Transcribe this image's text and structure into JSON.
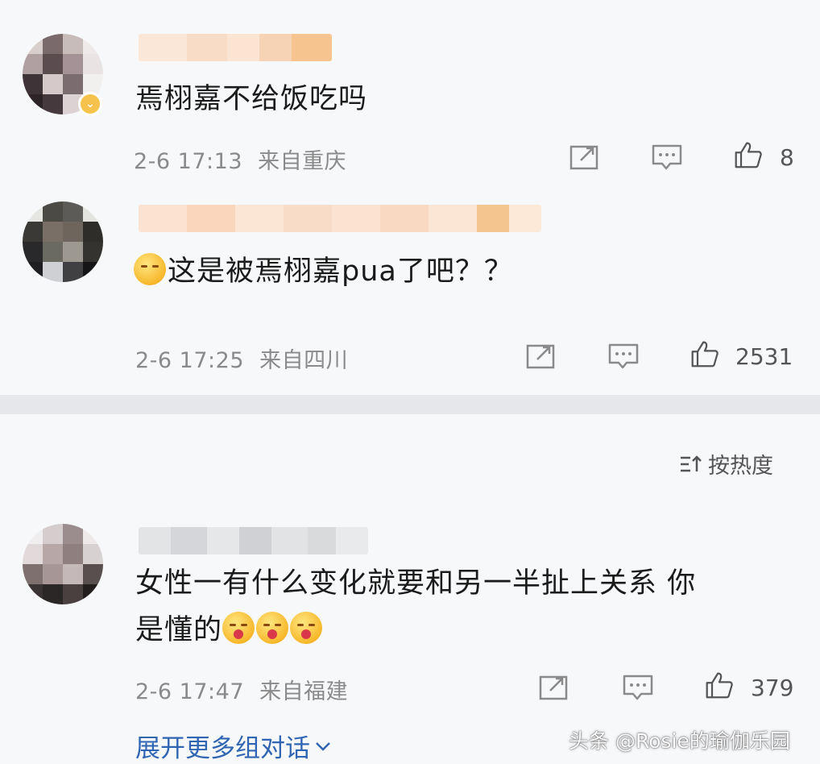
{
  "comments": [
    {
      "text": "焉栩嘉不给饭吃吗",
      "date": "2-6 17:13",
      "location": "来自重庆",
      "likes": "8",
      "has_emoji_prefix": false
    },
    {
      "text": "这是被焉栩嘉pua了吧？？",
      "date": "2-6 17:25",
      "location": "来自四川",
      "likes": "2531",
      "has_emoji_prefix": true
    },
    {
      "text_line1": "女性一有什么变化就要和另一半扯上关系 你",
      "text_line2": "是懂的",
      "date": "2-6 17:47",
      "location": "来自福建",
      "likes": "379",
      "emoji_count": 3
    }
  ],
  "sort": {
    "label": "按热度"
  },
  "expand": {
    "label": "展开更多组对话"
  },
  "watermark": "头条 @Rosie的瑜伽乐园",
  "colors": {
    "background": "#f7f8fa",
    "divider": "#e6e7ea",
    "link": "#2f65b3",
    "meta": "#8a8a8a",
    "vip_badge": "#f5c24c"
  },
  "icons": [
    "repost-icon",
    "comment-icon",
    "like-icon",
    "sort-icon",
    "chevron-down-icon",
    "vip-badge-icon"
  ]
}
